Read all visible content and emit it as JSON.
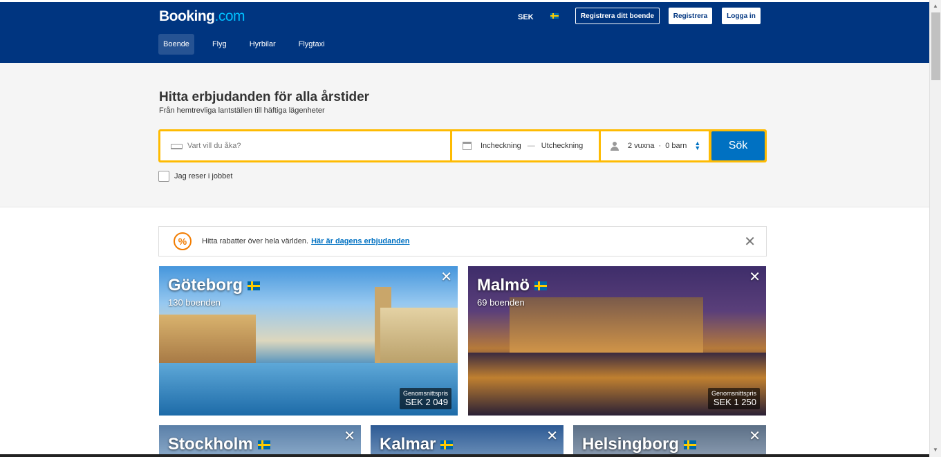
{
  "header": {
    "logo_main": "Booking",
    "logo_suffix": ".com",
    "currency": "SEK",
    "register_property": "Registrera ditt boende",
    "register": "Registrera",
    "login": "Logga in",
    "nav": [
      {
        "label": "Boende",
        "active": true
      },
      {
        "label": "Flyg"
      },
      {
        "label": "Hyrbilar"
      },
      {
        "label": "Flygtaxi"
      }
    ]
  },
  "hero": {
    "title": "Hitta erbjudanden för alla årstider",
    "subtitle": "Från hemtrevliga lantställen till häftiga lägenheter"
  },
  "search": {
    "destination_placeholder": "Vart vill du åka?",
    "checkin": "Incheckning",
    "separator": "—",
    "checkout": "Utcheckning",
    "adults": "2 vuxna",
    "dot": "·",
    "children": "0 barn",
    "button": "Sök",
    "business_travel": "Jag reser i jobbet"
  },
  "banner": {
    "text": "Hitta rabatter över hela världen.",
    "link": "Här är dagens erbjudanden"
  },
  "tiles": [
    {
      "city": "Göteborg",
      "count": "130 boenden",
      "price_label": "Genomsnittspris",
      "price": "SEK 2 049"
    },
    {
      "city": "Malmö",
      "count": "69 boenden",
      "price_label": "Genomsnittspris",
      "price": "SEK 1 250"
    },
    {
      "city": "Stockholm"
    },
    {
      "city": "Kalmar"
    },
    {
      "city": "Helsingborg"
    }
  ],
  "colors": {
    "brand": "#003580",
    "search_border": "#febb02",
    "primary_button": "#0071c2"
  },
  "icons": {
    "close": "✕",
    "deal": "%",
    "updown_up": "▲",
    "updown_down": "▼"
  }
}
